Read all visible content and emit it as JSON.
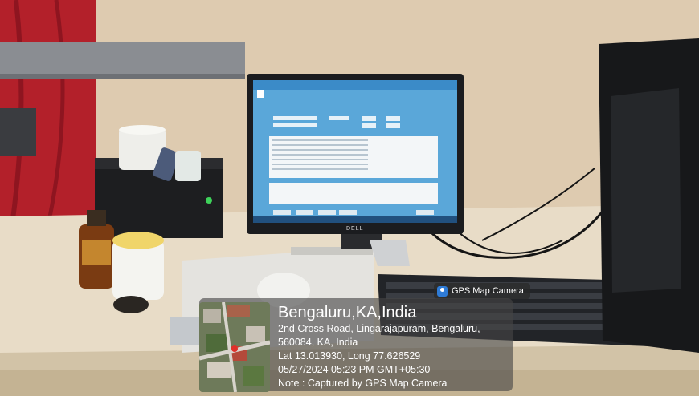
{
  "badge": {
    "label": "GPS Map Camera",
    "icon": "camera-pin-icon"
  },
  "stamp": {
    "city": "Bengaluru,KA,India",
    "address_line1": "2nd Cross Road, Lingarajapuram, Bengaluru,",
    "address_line2": "560084, KA, India",
    "coordinates": "Lat 13.013930, Long 77.626529",
    "datetime": "05/27/2024 05:23 PM GMT+05:30",
    "note": "Note : Captured by GPS Map Camera"
  },
  "monitor": {
    "brand": "DELL"
  },
  "colors": {
    "wall": "#d8c4a8",
    "desk": "#e9dfcc",
    "screen": "#5aa7d9",
    "curtain": "#b3202a"
  }
}
